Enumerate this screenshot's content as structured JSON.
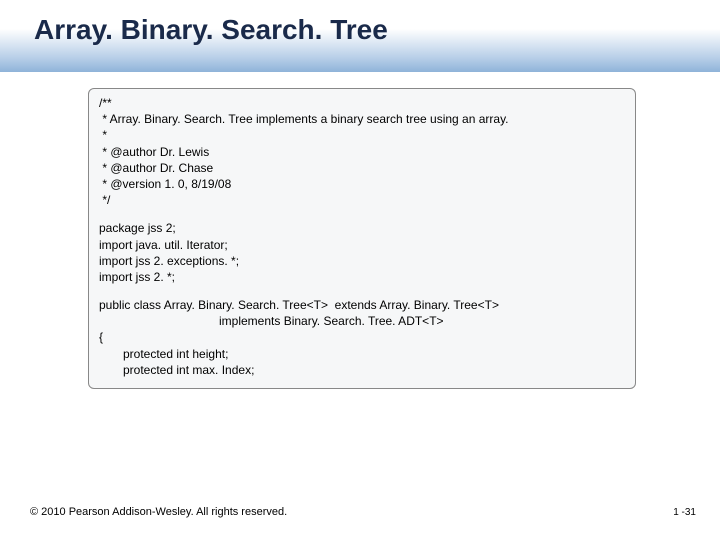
{
  "title": "Array. Binary. Search. Tree",
  "code": {
    "comment": {
      "l1": "/**",
      "l2": " * Array. Binary. Search. Tree implements a binary search tree using an array.",
      "l3": " *",
      "l4": " * @author Dr. Lewis",
      "l5": " * @author Dr. Chase",
      "l6": " * @version 1. 0, 8/19/08",
      "l7": " */"
    },
    "imports": {
      "l1": "package jss 2;",
      "l2": "import java. util. Iterator;",
      "l3": "import jss 2. exceptions. *;",
      "l4": "import jss 2. *;"
    },
    "classdef": {
      "l1": "public class Array. Binary. Search. Tree<T>  extends Array. Binary. Tree<T>",
      "l2": "implements Binary. Search. Tree. ADT<T>",
      "l3": "{",
      "l4": "protected int height;",
      "l5": "protected int max. Index;"
    }
  },
  "footer": {
    "copyright": "© 2010 Pearson Addison-Wesley. All rights reserved.",
    "page": "1 -31"
  }
}
